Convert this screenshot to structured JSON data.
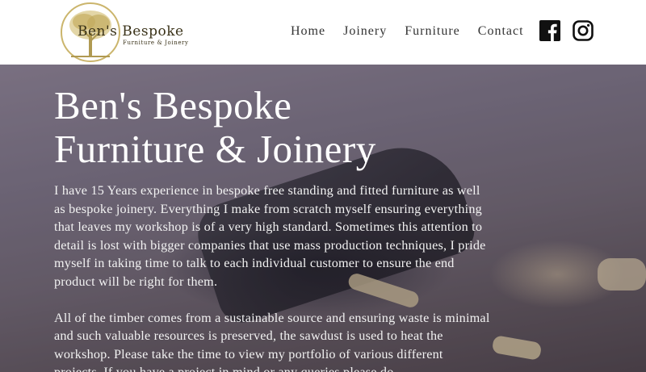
{
  "brand": {
    "title": "Ben's Bespoke",
    "subtitle": "Furniture & Joinery",
    "tree_color": "#c9b36a"
  },
  "nav": {
    "items": [
      {
        "label": "Home"
      },
      {
        "label": "Joinery"
      },
      {
        "label": "Furniture"
      },
      {
        "label": "Contact"
      }
    ]
  },
  "social": {
    "facebook_icon": "facebook-icon",
    "instagram_icon": "instagram-icon"
  },
  "hero": {
    "title_line1": "Ben's Bespoke",
    "title_line2": "Furniture & Joinery",
    "paragraph1": "I have 15 Years experience in bespoke free standing and fitted furniture as well as bespoke joinery. Everything I make from scratch myself ensuring everything that leaves my workshop is of a very high standard. Sometimes this attention to detail is lost with bigger companies that use mass production techniques, I pride myself in taking time to talk to each individual customer to ensure the end product will be right for them.",
    "paragraph2": "All of the timber comes from a sustainable source and ensuring waste is minimal and such valuable resources is preserved, the sawdust is used to heat the workshop. Please take the time to view my portfolio of various different projects. If you have a project in mind or any queries please do"
  }
}
